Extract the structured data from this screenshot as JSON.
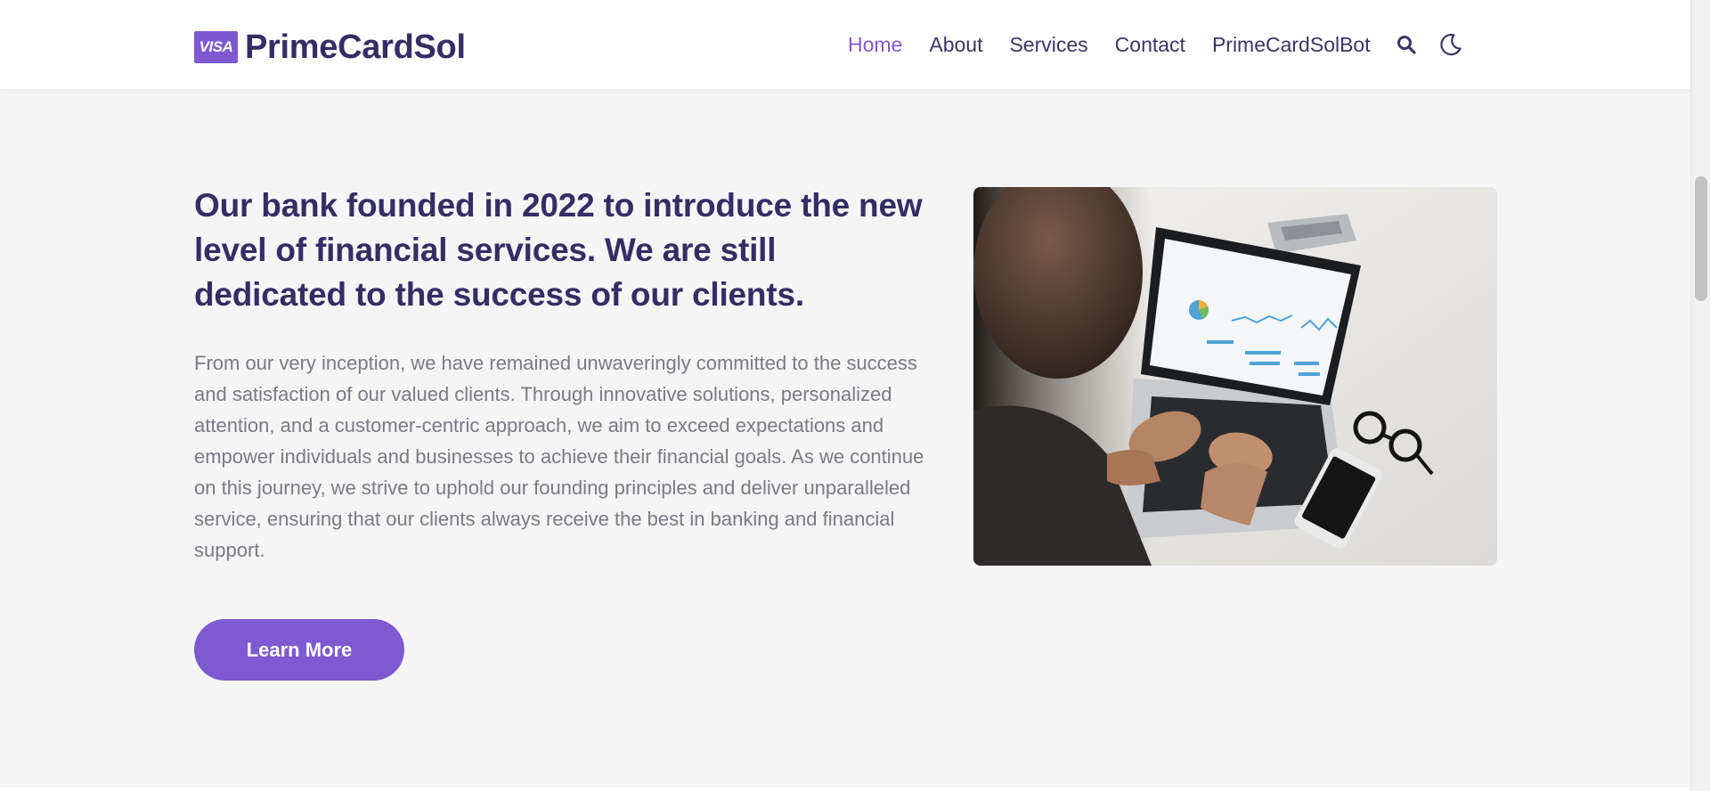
{
  "brand": {
    "badge": "VISA",
    "name": "PrimeCardSol"
  },
  "nav": {
    "items": [
      {
        "label": "Home",
        "active": true
      },
      {
        "label": "About",
        "active": false
      },
      {
        "label": "Services",
        "active": false
      },
      {
        "label": "Contact",
        "active": false
      },
      {
        "label": "PrimeCardSolBot",
        "active": false
      }
    ],
    "search_icon": "search-icon",
    "theme_icon": "moon-icon"
  },
  "main": {
    "headline": "Our bank founded in 2022 to introduce the new level of financial services. We are still dedicated to the success of our clients.",
    "paragraph": "From our very inception, we have remained unwaveringly committed to the success and satisfaction of our valued clients. Through innovative solutions, personalized attention, and a customer-centric approach, we aim to exceed expectations and empower individuals and businesses to achieve their financial goals. As we continue on this journey, we strive to uphold our founding principles and deliver unparalleled service, ensuring that our clients always receive the best in banking and financial support.",
    "cta_label": "Learn More"
  },
  "colors": {
    "accent": "#7e59d1",
    "heading": "#342e64",
    "body_text": "#7b7a83",
    "background": "#f5f5f6"
  }
}
